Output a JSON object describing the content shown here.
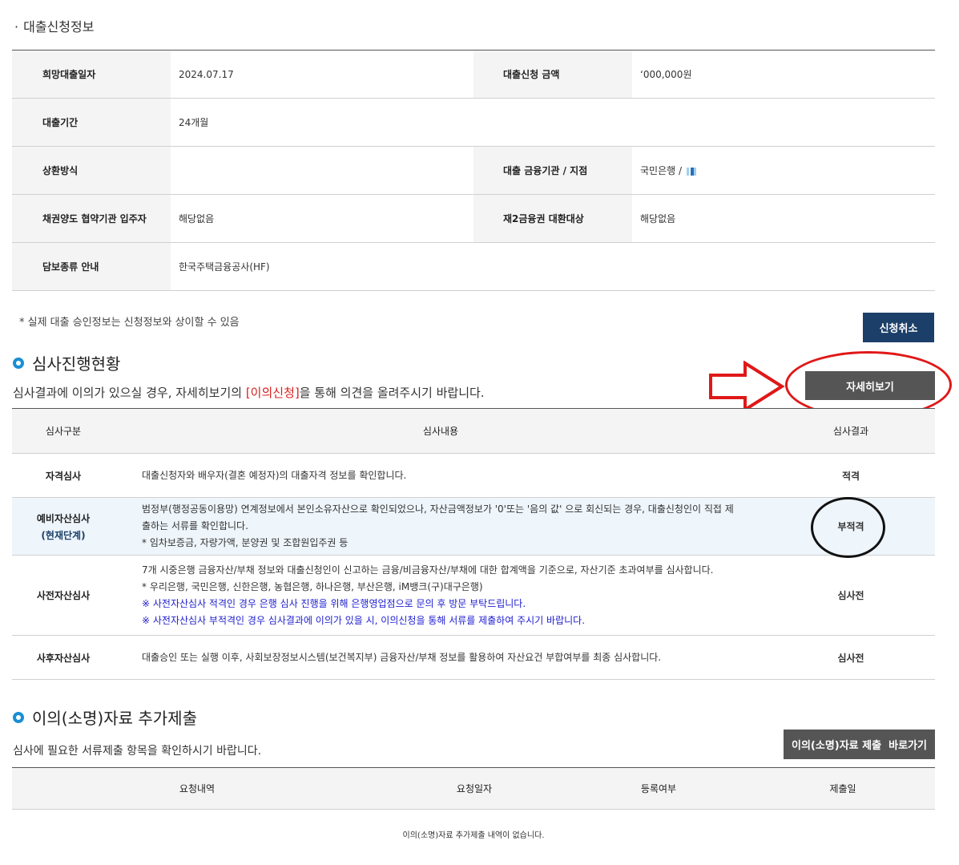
{
  "loan_info": {
    "title": "대출신청정보",
    "bullet": "·",
    "rows": [
      {
        "label1": "희망대출일자",
        "value1": "2024.07.17",
        "label2": "대출신청 금액",
        "value2": "ʻ000,000원"
      },
      {
        "label1": "대출기간",
        "value1": "24개월",
        "label2": "",
        "value2": ""
      },
      {
        "label1": "상환방식",
        "value1": "",
        "label2": "대출 금융기관 / 지점",
        "value2": "국민은행 / "
      },
      {
        "label1": "채권양도 협약기관 입주자",
        "value1": "해당없음",
        "label2": "재2금융권 대환대상",
        "value2": "해당없음"
      },
      {
        "label1": "담보종류 안내",
        "value1": "한국주택금융공사(HF)",
        "label2": "",
        "value2": ""
      }
    ],
    "note": "* 실제 대출 승인정보는 신청정보와 상이할 수 있음",
    "cancel_button": "신청취소"
  },
  "review": {
    "title": "심사진행현황",
    "desc_before": "심사결과에 이의가 있으실 경우, 자세히보기의 ",
    "desc_highlight": "[이의신청]",
    "desc_after": "을 통해 의견을 올려주시기 바랍니다.",
    "detail_button": "자세히보기",
    "headers": {
      "category": "심사구분",
      "content": "심사내용",
      "result": "심사결과"
    },
    "rows": [
      {
        "category": "자격심사",
        "sub": "",
        "lines": [
          "대출신청자와 배우자(결혼 예정자)의 대출자격 정보를 확인합니다."
        ],
        "blue_lines": [],
        "result": "적격"
      },
      {
        "category": "예비자산심사",
        "sub": "(현재단계)",
        "lines": [
          "범정부(행정공동이용망) 연계정보에서 본인소유자산으로 확인되었으나, 자산금액정보가 '0'또는 '음의 값' 으로 회신되는 경우, 대출신청인이 직접 제",
          "출하는 서류를 확인합니다.",
          "* 임차보증금, 자량가액, 분양권 및 조합원입주권 등"
        ],
        "blue_lines": [],
        "result": "부적격"
      },
      {
        "category": "사전자산심사",
        "sub": "",
        "lines": [
          "7개 시중은행 금융자산/부채 정보와 대출신청인이 신고하는 금융/비금융자산/부채에 대한 합계액을 기준으로, 자산기준 초과여부를 심사합니다.",
          "* 우리은행, 국민은행, 신한은행, 농협은행, 하나은행, 부산은행, iM뱅크(구)대구은행)"
        ],
        "blue_lines": [
          "※ 사전자산심사 적격인 경우 은행 심사 진행을 위해 은행영업점으로 문의 후 방문 부탁드립니다.",
          "※ 사전자산심사 부적격인 경우 심사결과에 이의가 있을 시, 이의신청을 통해 서류를 제출하여 주시기 바랍니다."
        ],
        "result": "심사전"
      },
      {
        "category": "사후자산심사",
        "sub": "",
        "lines": [
          "대출승인 또는 실행 이후, 사회보장정보시스템(보건복지부) 금융자산/부채 정보를 활용하여 자산요건 부합여부를 최종 심사합니다."
        ],
        "blue_lines": [],
        "result": "심사전"
      }
    ]
  },
  "objection": {
    "title": "이의(소명)자료 추가제출",
    "desc": "심사에 필요한 서류제출 항목을 확인하시기 바랍니다.",
    "button": "이의(소명)자료 제출  바로가기",
    "headers": [
      "요청내역",
      "요청일자",
      "등록여부",
      "제출일"
    ],
    "empty_message": "이의(소명)자료 추가제출 내역이 없습니다."
  },
  "colors": {
    "accent_blue": "#1a8fd4",
    "navy_button": "#1b3f68",
    "highlight_red": "#d8201e",
    "annotation_red": "#e01818"
  }
}
